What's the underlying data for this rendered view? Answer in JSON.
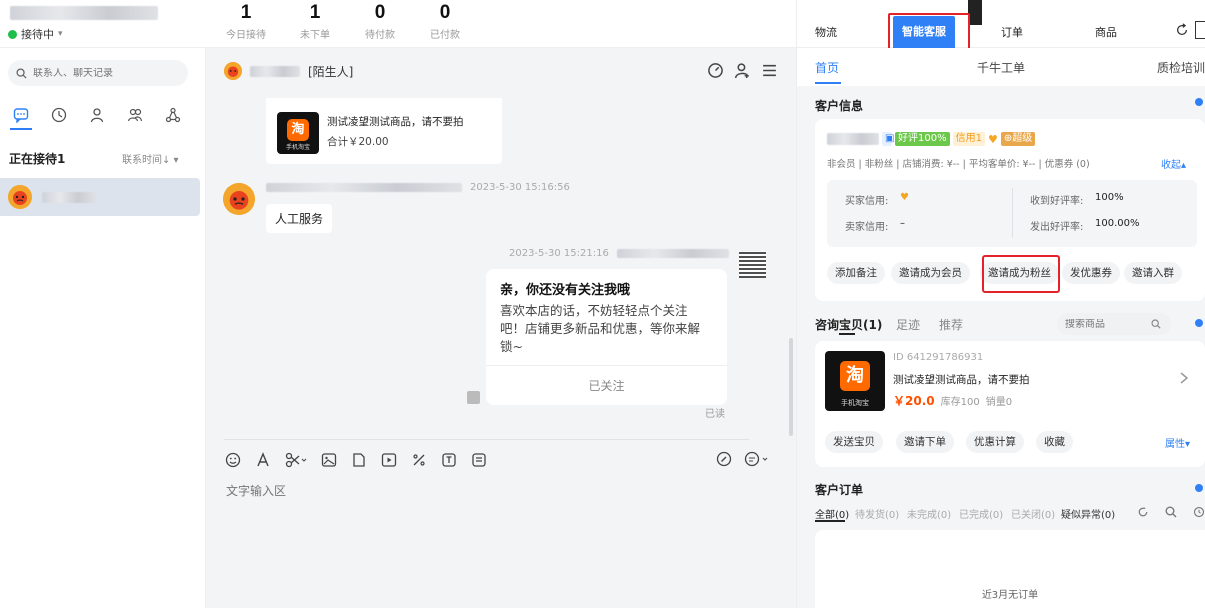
{
  "topbar": {
    "status": "接待中",
    "stats": [
      {
        "num": "1",
        "label": "今日接待"
      },
      {
        "num": "1",
        "label": "未下单"
      },
      {
        "num": "0",
        "label": "待付款"
      },
      {
        "num": "0",
        "label": "已付款"
      }
    ]
  },
  "left": {
    "search_placeholder": "联系人、聊天记录",
    "waiting_header": "正在接待1",
    "sort_label": "联系时间↓ ▾"
  },
  "chat": {
    "visitor_tag": "[陌生人]",
    "product_title": "测试凌望测试商品，请不要拍",
    "product_total": "合计￥20.00",
    "product_img_text": "淘",
    "product_img_caption": "手机淘宝",
    "msg1_time": "2023-5-30 15:16:56",
    "msg1_text": "人工服务",
    "msg2_time": "2023-5-30 15:21:16",
    "follow_title": "亲，你还没有关注我哦",
    "follow_body": "喜欢本店的话，不妨轻轻点个关注吧！店铺更多新品和优惠，等你来解锁~",
    "follow_action": "已关注",
    "read_label": "已读",
    "input_placeholder": "文字输入区"
  },
  "right": {
    "tabs": [
      "物流",
      "智能客服",
      "订单",
      "商品"
    ],
    "subtabs": [
      "首页",
      "千牛工单",
      "质检培训"
    ],
    "customer_info_title": "客户信息",
    "badges": {
      "good_rate": "好评100%",
      "credit": "信用1",
      "super": "超级"
    },
    "member_line": "非会员 | 非粉丝 | 店铺消费: ¥-- | 平均客单价: ¥-- | 优惠券 (0)",
    "collapse_label": "收起▴",
    "buyer_credit_label": "买家信用:",
    "seller_credit_label": "卖家信用:",
    "seller_credit_value": "–",
    "received_good_label": "收到好评率:",
    "received_good_value": "100%",
    "sent_good_label": "发出好评率:",
    "sent_good_value": "100.00%",
    "actions": [
      "添加备注",
      "邀请成为会员",
      "邀请成为粉丝",
      "发优惠券",
      "邀请入群"
    ],
    "consult_tabs": [
      "咨询宝贝(1)",
      "足迹",
      "推荐"
    ],
    "product_search_placeholder": "搜索商品",
    "product": {
      "id": "ID 641291786931",
      "title": "测试凌望测试商品，请不要拍",
      "price": "￥20.0",
      "stock": "库存100",
      "sales": "销量0"
    },
    "product_actions": [
      "发送宝贝",
      "邀请下单",
      "优惠计算",
      "收藏"
    ],
    "attr_label": "属性▾",
    "orders_title": "客户订单",
    "order_tabs": [
      "全部(0)",
      "待发货(0)",
      "未完成(0)",
      "已完成(0)",
      "已关闭(0)",
      "疑似异常(0)"
    ],
    "no_orders": "近3月无订单"
  },
  "colors": {
    "accent": "#2f80f7",
    "highlight": "#e5212a",
    "online": "#1fbf4a",
    "price": "#ff5000"
  }
}
